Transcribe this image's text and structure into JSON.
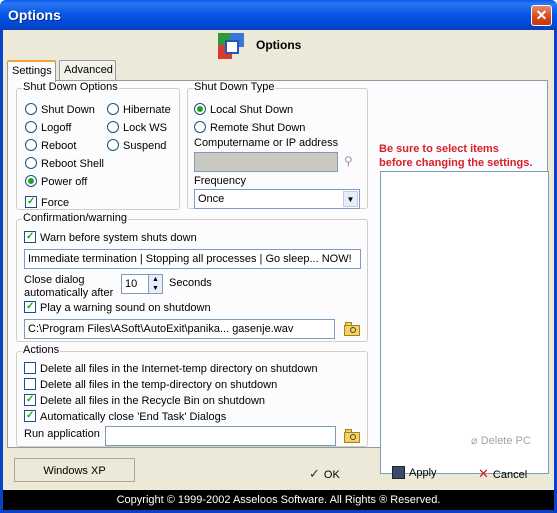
{
  "window": {
    "title": "Options",
    "close_glyph": "✕"
  },
  "header": {
    "title": "Options",
    "logo_icon": "app-logo-icon"
  },
  "tabs": [
    {
      "label": "Settings",
      "active": true
    },
    {
      "label": "Advanced",
      "active": false
    }
  ],
  "shutdown_options": {
    "legend": "Shut Down Options",
    "left_options": [
      {
        "label": "Shut Down",
        "selected": false
      },
      {
        "label": "Logoff",
        "selected": false
      },
      {
        "label": "Reboot",
        "selected": false
      },
      {
        "label": "Reboot Shell",
        "selected": false
      },
      {
        "label": "Power off",
        "selected": true
      }
    ],
    "right_options": [
      {
        "label": "Hibernate",
        "selected": false
      },
      {
        "label": "Lock WS",
        "selected": false
      },
      {
        "label": "Suspend",
        "selected": false
      }
    ],
    "force": {
      "label": "Force",
      "checked": true
    }
  },
  "shutdown_type": {
    "legend": "Shut Down Type",
    "local": {
      "label": "Local Shut Down",
      "selected": true
    },
    "remote": {
      "label": "Remote Shut Down",
      "selected": false
    },
    "computer_label": "Computername or IP address",
    "computer_value": "",
    "frequency_label": "Frequency",
    "frequency_value": "Once"
  },
  "confirmation": {
    "legend": "Confirmation/warning",
    "warn": {
      "label": "Warn before system shuts down",
      "checked": true
    },
    "message": "Immediate termination | Stopping all processes | Go sleep... NOW!",
    "close_dialog_label_1": "Close dialog",
    "close_dialog_label_2": "automatically after",
    "seconds_value": "10",
    "seconds_label": "Seconds",
    "sound": {
      "label": "Play a warning sound on shutdown",
      "checked": true
    },
    "sound_path": "C:\\Program Files\\ASoft\\AutoExit\\panika... gasenje.wav"
  },
  "actions": {
    "legend": "Actions",
    "items": [
      {
        "label": "Delete all files in the Internet-temp directory on shutdown",
        "checked": false
      },
      {
        "label": "Delete all files in the temp-directory on shutdown",
        "checked": false
      },
      {
        "label": "Delete all files in the Recycle Bin on shutdown",
        "checked": true
      },
      {
        "label": "Automatically close 'End Task' Dialogs",
        "checked": true
      }
    ],
    "run_app_label": "Run application",
    "run_app_value": ""
  },
  "right_panel": {
    "warning_line1": "Be sure to select items",
    "warning_line2": "before changing the settings.",
    "delete_pc_label": "Delete PC"
  },
  "buttons": {
    "ok": "OK",
    "apply": "Apply",
    "cancel": "Cancel"
  },
  "status": {
    "os": "Windows XP"
  },
  "footer": {
    "copyright": "Copyright © 1999-2002 Asseloos Software. All Rights ® Reserved."
  },
  "colors": {
    "accent": "#0842c6",
    "warning": "#d6202a",
    "check": "#21a121"
  }
}
